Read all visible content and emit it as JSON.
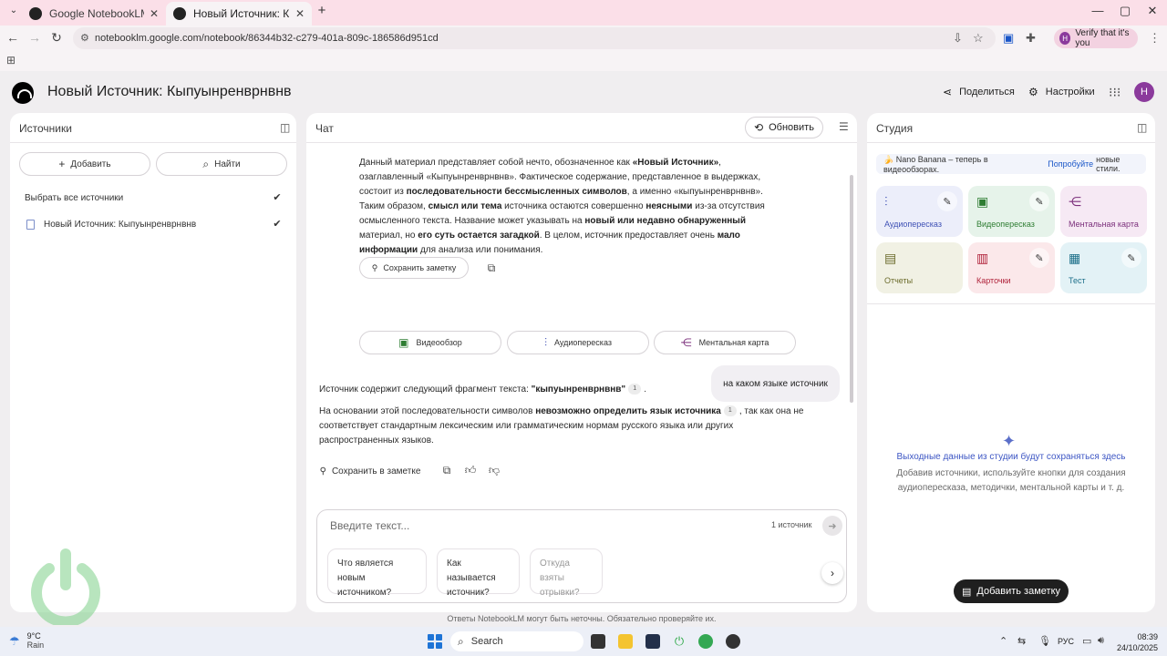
{
  "browser": {
    "tabs": [
      {
        "title": "Google NotebookLM | AI Resea",
        "active": false
      },
      {
        "title": "Новый Источник: Кыпуынре",
        "active": true
      }
    ],
    "url": "notebooklm.google.com/notebook/86344b32-c279-401a-809c-186586d951cd",
    "verify_label": "Verify that it's you",
    "profile_initial": "H"
  },
  "header": {
    "title": "Новый Источник: Кыпуынренврнвнв",
    "share_label": "Поделиться",
    "settings_label": "Настройки",
    "user_initial": "H"
  },
  "sources": {
    "title": "Источники",
    "add_label": "Добавить",
    "find_label": "Найти",
    "select_all_label": "Выбрать все источники",
    "items": [
      {
        "label": "Новый Источник: Кыпуынренврнвнв",
        "checked": true
      }
    ]
  },
  "chat": {
    "title": "Чат",
    "refresh_label": "Обновить",
    "first_answer_html": "Данный материал представляет собой нечто, обозначенное как <b>«Новый Источник»</b>, озаглавленный «Кыпуынренврнвнв». Фактическое содержание, представленное в выдержках, состоит из <b>последовательности бессмысленных символов</b>, а именно «кыпуынренврнвнв». Таким образом, <b>смысл или тема</b> источника остаются совершенно <b>неясными</b> из-за отсутствия осмысленного текста. Название может указывать на <b>новый или недавно обнаруженный</b> материал, но <b>его суть остается загадкой</b>. В целом, источник предоставляет очень <b>мало информации</b> для анализа или понимания.",
    "save_note_label": "Сохранить заметку",
    "gen_buttons": [
      "Видеообзор",
      "Аудиопересказ",
      "Ментальная карта"
    ],
    "user_message": "на каком языке источник",
    "answer_line1_prefix": "Источник содержит следующий фрагмент текста: ",
    "answer_line1_bold": "\"кыпуынренврнвнв\"",
    "cite_num": "1",
    "answer_line2_prefix": "На основании этой последовательности символов ",
    "answer_line2_bold": "невозможно определить язык источника",
    "answer_line2_rest": ", так как она не соответствует стандартным лексическим или грамматическим нормам русского языка или других распространенных языков.",
    "save_in_note_label": "Сохранить в заметке",
    "input_placeholder": "Введите текст...",
    "source_count": "1 источник",
    "suggestions": [
      "Что является новым источником?",
      "Как называется источник?",
      "Откуда взяты отрывки?"
    ],
    "disclaimer": "Ответы NotebookLM могут быть неточны. Обязательно проверяйте их."
  },
  "studio": {
    "title": "Студия",
    "banner_prefix": "🍌 Nano Banana – теперь в видеообзорах.",
    "banner_link": "Попробуйте",
    "banner_suffix": "новые стили.",
    "tiles": [
      {
        "label": "Аудиопересказ",
        "bg": "#eceefa",
        "color": "#3f51b5",
        "icon": "audio-waves-icon",
        "edit": true
      },
      {
        "label": "Видеопересказ",
        "bg": "#e6f3ea",
        "color": "#2e7d32",
        "icon": "video-icon",
        "edit": true
      },
      {
        "label": "Ментальная карта",
        "bg": "#f6e9f4",
        "color": "#7b2f7b",
        "icon": "mind-map-icon",
        "edit": false
      },
      {
        "label": "Отчеты",
        "bg": "#f1f1e4",
        "color": "#6b6b2b",
        "icon": "report-icon",
        "edit": false
      },
      {
        "label": "Карточки",
        "bg": "#fbe8ea",
        "color": "#b0223a",
        "icon": "cards-icon",
        "edit": true
      },
      {
        "label": "Тест",
        "bg": "#e3f2f6",
        "color": "#1c6f89",
        "icon": "quiz-icon",
        "edit": true
      }
    ],
    "empty_title": "Выходные данные из студии будут сохраняться здесь",
    "empty_text": "Добавив источники, используйте кнопки для создания аудиопересказа, методички, ментальной карты и т. д.",
    "add_note_label": "Добавить заметку"
  },
  "taskbar": {
    "temp": "9°C",
    "weather": "Rain",
    "search_label": "Search",
    "lang": "РУС",
    "time": "08:39",
    "date": "24/10/2025"
  }
}
